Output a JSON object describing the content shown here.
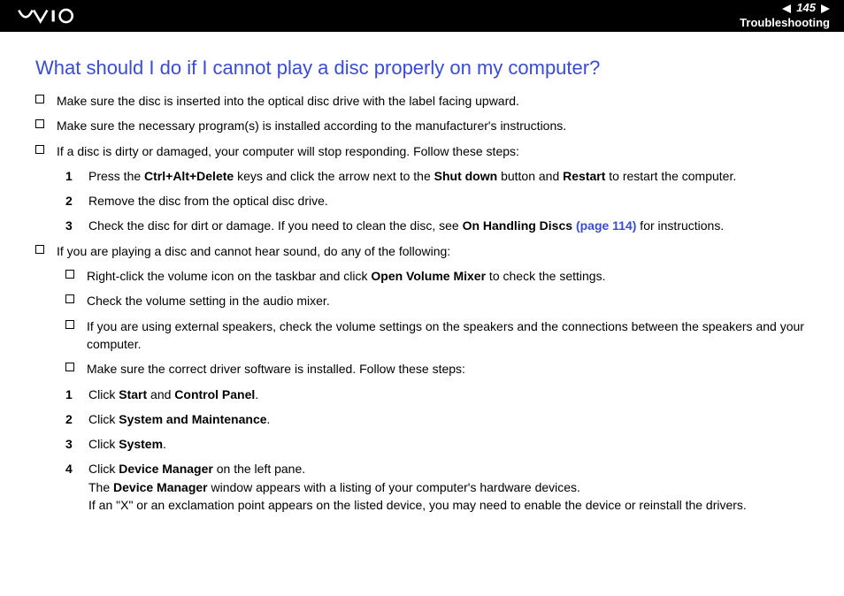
{
  "header": {
    "page_number": "145",
    "section": "Troubleshooting"
  },
  "title": "What should I do if I cannot play a disc properly on my computer?",
  "b1": "Make sure the disc is inserted into the optical disc drive with the label facing upward.",
  "b2": "Make sure the necessary program(s) is installed according to the manufacturer's instructions.",
  "b3": "If a disc is dirty or damaged, your computer will stop responding. Follow these steps:",
  "s1_num": "1",
  "s1_a": "Press the ",
  "s1_b": "Ctrl+Alt+Delete",
  "s1_c": " keys and click the arrow next to the ",
  "s1_d": "Shut down",
  "s1_e": " button and ",
  "s1_f": "Restart",
  "s1_g": " to restart the computer.",
  "s2_num": "2",
  "s2": "Remove the disc from the optical disc drive.",
  "s3_num": "3",
  "s3_a": "Check the disc for dirt or damage. If you need to clean the disc, see ",
  "s3_b": "On Handling Discs ",
  "s3_c": "(page 114)",
  "s3_d": " for instructions.",
  "b4": "If you are playing a disc and cannot hear sound, do any of the following:",
  "b5_a": "Right-click the volume icon on the taskbar and click ",
  "b5_b": "Open Volume Mixer",
  "b5_c": " to check the settings.",
  "b6": "Check the volume setting in the audio mixer.",
  "b7": "If you are using external speakers, check the volume settings on the speakers and the connections between the speakers and your computer.",
  "b8": "Make sure the correct driver software is installed. Follow these steps:",
  "n1_num": "1",
  "n1_a": "Click ",
  "n1_b": "Start",
  "n1_c": " and ",
  "n1_d": "Control Panel",
  "n1_e": ".",
  "n2_num": "2",
  "n2_a": "Click ",
  "n2_b": "System and Maintenance",
  "n2_c": ".",
  "n3_num": "3",
  "n3_a": "Click ",
  "n3_b": "System",
  "n3_c": ".",
  "n4_num": "4",
  "n4_a": "Click ",
  "n4_b": "Device Manager",
  "n4_c": " on the left pane.",
  "n4_line2_a": "The ",
  "n4_line2_b": "Device Manager",
  "n4_line2_c": " window appears with a listing of your computer's hardware devices.",
  "n4_line3": "If an \"X\" or an exclamation point appears on the listed device, you may need to enable the device or reinstall the drivers."
}
